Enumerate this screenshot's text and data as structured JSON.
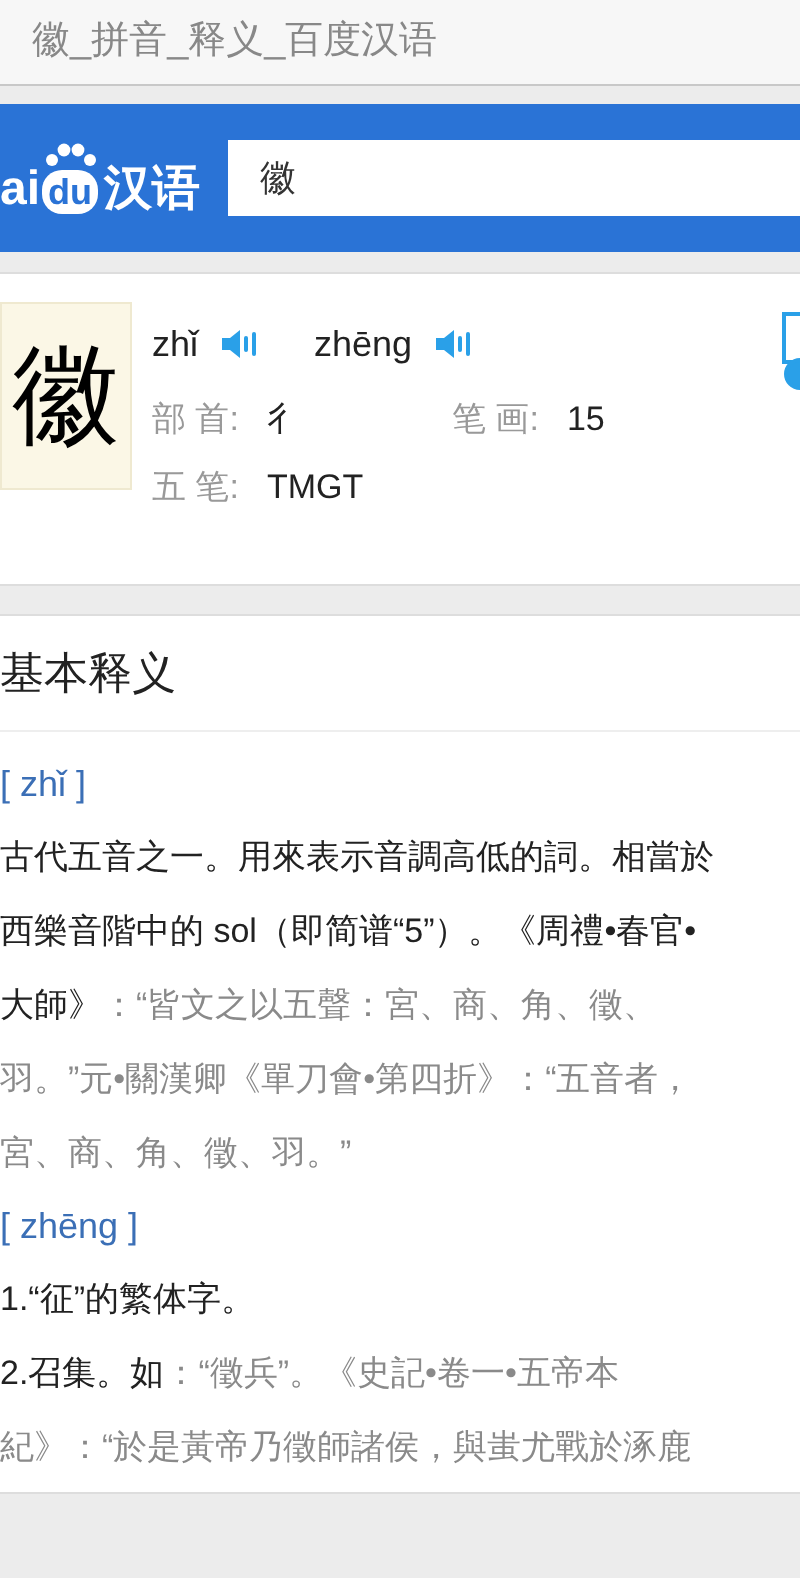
{
  "page_title": "徽_拼音_释义_百度汉语",
  "header": {
    "logo": {
      "part_1": "ai",
      "part_2": "du",
      "part_3": "汉语"
    },
    "search": {
      "value": "徽"
    }
  },
  "character": {
    "glyph": "徽",
    "readings": [
      {
        "pinyin": "zhǐ"
      },
      {
        "pinyin": "zhēng"
      }
    ],
    "facts": [
      {
        "label": "部 首:",
        "value": "彳"
      },
      {
        "label": "笔 画:",
        "value": "15"
      },
      {
        "label": "五 笔:",
        "value": "TMGT"
      }
    ]
  },
  "definitions": {
    "heading": "基本释义",
    "entries": [
      {
        "pinyin": "[ zhǐ ]",
        "lines": [
          [
            {
              "kind": "text",
              "text": "古代五音之一。用來表示音調高低的詞。相當於"
            }
          ],
          [
            {
              "kind": "text",
              "text": "西樂音階中的 sol（即简谱“5”）。《周禮•春官•"
            }
          ],
          [
            {
              "kind": "text",
              "text": "大師》"
            },
            {
              "kind": "quote",
              "text": "：“皆文之以五聲：宮、商、角、徵、"
            }
          ],
          [
            {
              "kind": "quote",
              "text": "羽。”元•關漢卿《單刀會•第四折》：“五音者，"
            }
          ],
          [
            {
              "kind": "quote",
              "text": "宮、商、角、徵、羽。”"
            }
          ]
        ]
      },
      {
        "pinyin": "[ zhēng ]",
        "lines": [
          [
            {
              "kind": "text",
              "text": "1.“征”的繁体字。"
            }
          ],
          [
            {
              "kind": "text",
              "text": "2.召集。如"
            },
            {
              "kind": "quote",
              "text": "：“徵兵”。《史記•卷一•五帝本"
            }
          ],
          [
            {
              "kind": "quote",
              "text": "紀》：“於是黃帝乃徵師諸侯，與蚩尤戰於涿鹿"
            }
          ]
        ]
      }
    ]
  }
}
